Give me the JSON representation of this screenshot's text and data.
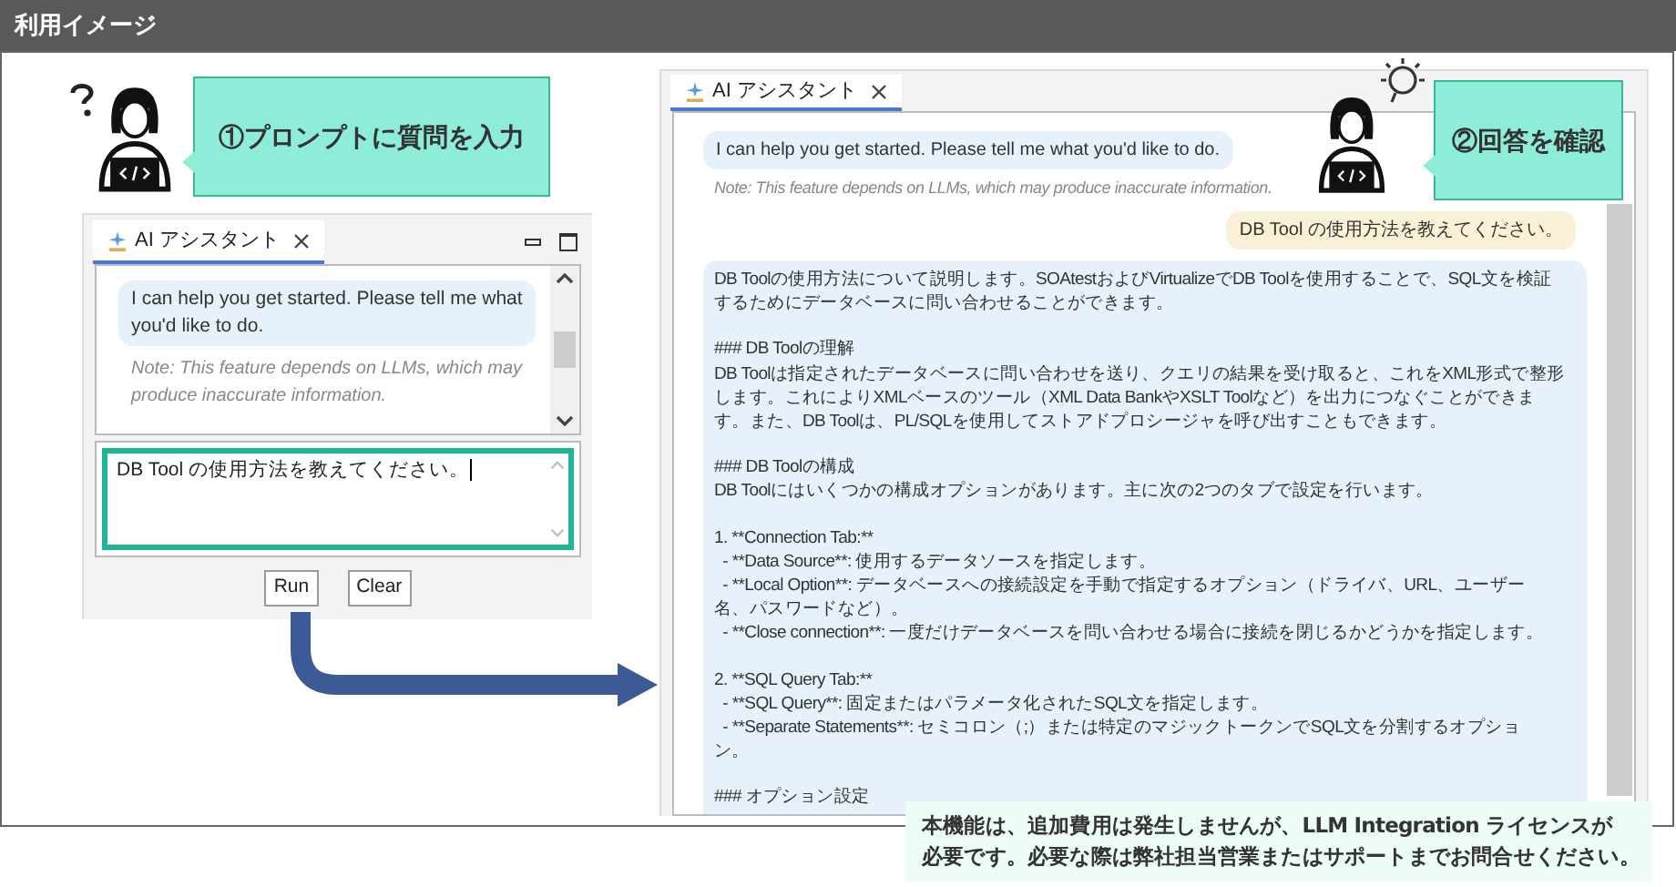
{
  "header": {
    "title": "利用イメージ"
  },
  "callouts": [
    {
      "text": "①プロンプトに質問を入力"
    },
    {
      "text": "②回答を確認"
    }
  ],
  "left_panel": {
    "tab": {
      "label": "AI アシスタント",
      "selected": true
    },
    "assistant_message": "I can help you get started. Please tell me what you'd like to do.",
    "note": "Note: This feature depends on LLMs, which may produce inaccurate information.",
    "prompt_input": {
      "value": "DB Tool の使用方法を教えてください。"
    },
    "buttons": [
      "Run",
      "Clear"
    ]
  },
  "right_panel": {
    "tab": {
      "label": "AI アシスタント",
      "selected": true
    },
    "assistant_message": "I can help you get started. Please tell me what you'd like to do.",
    "note": "Note: This feature depends on LLMs, which may produce inaccurate information.",
    "user_message": "DB Tool の使用方法を教えてください。",
    "response": [
      [
        "DB Toolの使用方法について説明します。SOAtestおよびVirtualizeでDB Toolを使用することで、SQL文を検証",
        "するためにデータベースに問い合わせることができます。"
      ],
      [
        "### DB Toolの理解",
        "DB Toolは指定されたデータベースに問い合わせを送り、クエリの結果を受け取ると、これをXML形式で整形",
        "します。これによりXMLベースのツール（XML Data BankやXSLT Toolなど）を出力につなぐことができま",
        "す。また、DB Toolは、PL/SQLを使用してストアドプロシージャを呼び出すこともできます。"
      ],
      [
        "### DB Toolの構成",
        "DB Toolにはいくつかの構成オプションがあります。主に次の2つのタブで設定を行います。"
      ],
      [
        "1. **Connection Tab:**",
        "  - **Data Source**: 使用するデータソースを指定します。",
        "  - **Local Option**: データベースへの接続設定を手動で指定するオプション（ドライバ、URL、ユーザー",
        "名、パスワードなど）。",
        "  - **Close connection**: 一度だけデータベースを問い合わせる場合に接続を閉じるかどうかを指定します。"
      ],
      [
        "2. **SQL Query Tab:**",
        "  - **SQL Query**: 固定またはパラメータ化されたSQL文を指定します。",
        "  - **Separate Statements**: セミコロン（;）または特定のマジックトークンでSQL文を分割するオプショ",
        "ン。"
      ],
      [
        "### オプション設定"
      ]
    ]
  },
  "footer_note": [
    "本機能は、追加費用は発生しませんが、LLM Integration ライセンスが",
    "必要です。必要な際は弊社担当営業またはサポートまでお問合せください。"
  ]
}
